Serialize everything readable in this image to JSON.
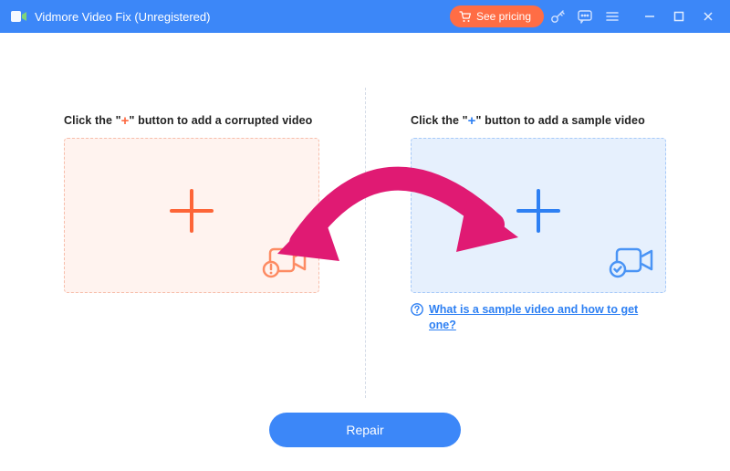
{
  "titlebar": {
    "app_title": "Vidmore Video Fix (Unregistered)",
    "pricing_label": "See pricing"
  },
  "panels": {
    "left": {
      "instr_prefix": "Click the \"",
      "instr_plus": "+",
      "instr_suffix": "\" button to add a corrupted video"
    },
    "right": {
      "instr_prefix": "Click the \"",
      "instr_plus": "+",
      "instr_suffix": "\" button to add a sample video"
    }
  },
  "help_link": "What is a sample video and how to get one?",
  "repair_label": "Repair",
  "colors": {
    "brand_blue": "#3c87f8",
    "accent_orange": "#fd6538",
    "pricing_orange": "#ff6d45",
    "arrow_pink": "#e01a73"
  }
}
